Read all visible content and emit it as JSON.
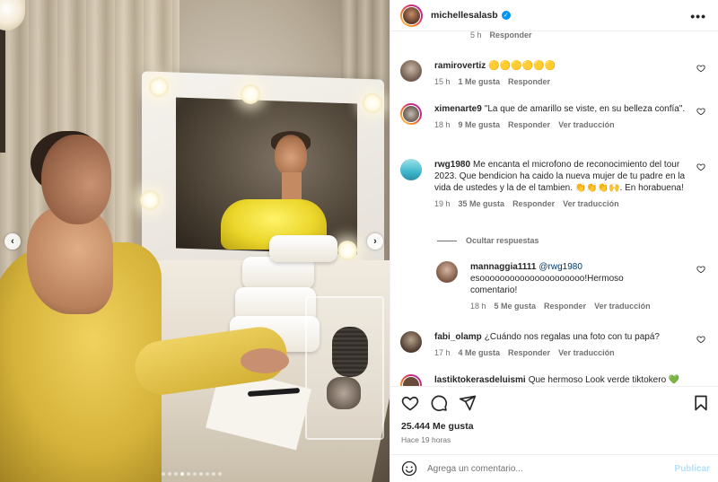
{
  "post": {
    "image_alt": "Mujer con vestido amarillo frente a un espejo de camerino",
    "carousel": {
      "total": 10,
      "active_index": 3
    }
  },
  "header": {
    "username": "michellesalasb",
    "verified": true
  },
  "comments_top_partial": {
    "time": "5 h",
    "reply": "Responder"
  },
  "comments": [
    {
      "username": "ramirovertiz",
      "text": "🟡🟡🟡🟡🟡🟡",
      "time": "15 h",
      "likes": "1 Me gusta",
      "reply": "Responder",
      "translate": ""
    },
    {
      "username": "ximenarte9",
      "text": "\"La que de amarillo se viste, en su belleza confía\".",
      "time": "18 h",
      "likes": "9 Me gusta",
      "reply": "Responder",
      "translate": "Ver traducción"
    },
    {
      "username": "rwg1980",
      "text": "Me encanta el microfono de reconocimiento del tour 2023. Que bendicion ha caido la nueva mujer de tu padre en la vida de ustedes y la de el tambien. 👏👏👏🙌. En horabuena!",
      "time": "19 h",
      "likes": "35 Me gusta",
      "reply": "Responder",
      "translate": "Ver traducción"
    },
    {
      "username": "fabi_olamp",
      "text": "¿Cuándo nos regalas una foto con tu papá?",
      "time": "17 h",
      "likes": "4 Me gusta",
      "reply": "Responder",
      "translate": "Ver traducción"
    }
  ],
  "hide_replies": "Ocultar respuestas",
  "reply": {
    "username": "mannaggia1111",
    "mention": "@rwg1980",
    "text": "esooooooooooooooooooooo!Hermoso comentario!",
    "time": "18 h",
    "likes": "5 Me gusta",
    "reply": "Responder",
    "translate": "Ver traducción"
  },
  "comment_bottom_partial": {
    "username": "lastiktokerasdeluismi",
    "text": "Que hermoso Look verde tiktokero 💚"
  },
  "footer": {
    "likes": "25.444 Me gusta",
    "time": "Hace 19 horas",
    "comment_placeholder": "Agrega un comentario...",
    "post_button": "Publicar"
  },
  "colors": {
    "link": "#00376b",
    "verified": "#0095f6",
    "post_disabled": "#b2dffc",
    "meta": "#737373"
  }
}
